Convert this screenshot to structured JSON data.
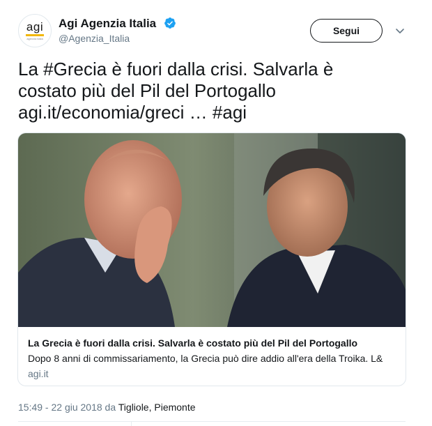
{
  "account": {
    "avatar_word": "agi",
    "avatar_subtext": "agenzia italia",
    "display_name": "Agi Agenzia Italia",
    "handle": "@Agenzia_Italia"
  },
  "actions": {
    "follow_label": "Segui"
  },
  "tweet": {
    "line1": "La #Grecia è fuori dalla crisi. Salvarla è",
    "line2": "costato più del Pil del Portogallo",
    "line3": "agi.it/economia/greci … #agi"
  },
  "card": {
    "title": "La Grecia è fuori dalla crisi. Salvarla è costato più del Pil del Portogallo",
    "description": "Dopo 8 anni di commissariamento, la Grecia può dire addio all'era della Troika. L&",
    "domain": "agi.it"
  },
  "meta": {
    "timestamp": "15:49 - 22 giu 2018",
    "location_prefix": "da",
    "location": "Tigliole, Piemonte"
  },
  "colors": {
    "text": "#14171a",
    "secondary": "#657786",
    "verified": "#1da1f2",
    "border": "#e1e8ed",
    "agi_accent": "#f2b705"
  },
  "icons": {
    "verified": "verified-badge-icon",
    "caret": "chevron-down-icon"
  }
}
